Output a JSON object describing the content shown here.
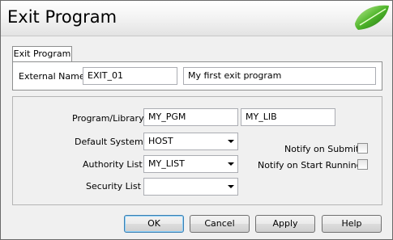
{
  "window": {
    "title": "Exit Program"
  },
  "tabs": [
    {
      "label": "Exit Program"
    }
  ],
  "general": {
    "external_name_label": "External Name",
    "external_name_value": "EXIT_01",
    "description_value": "My first exit program"
  },
  "details": {
    "program_library_label": "Program/Library",
    "program_value": "MY_PGM",
    "library_value": "MY_LIB",
    "default_system_label": "Default System",
    "default_system_value": "HOST",
    "authority_list_label": "Authority List",
    "authority_list_value": "MY_LIST",
    "security_list_label": "Security List",
    "security_list_value": "",
    "notify_submit_label": "Notify on Submit",
    "notify_start_label": "Notify on Start Running"
  },
  "buttons": {
    "ok": "OK",
    "cancel": "Cancel",
    "apply": "Apply",
    "help": "Help"
  }
}
